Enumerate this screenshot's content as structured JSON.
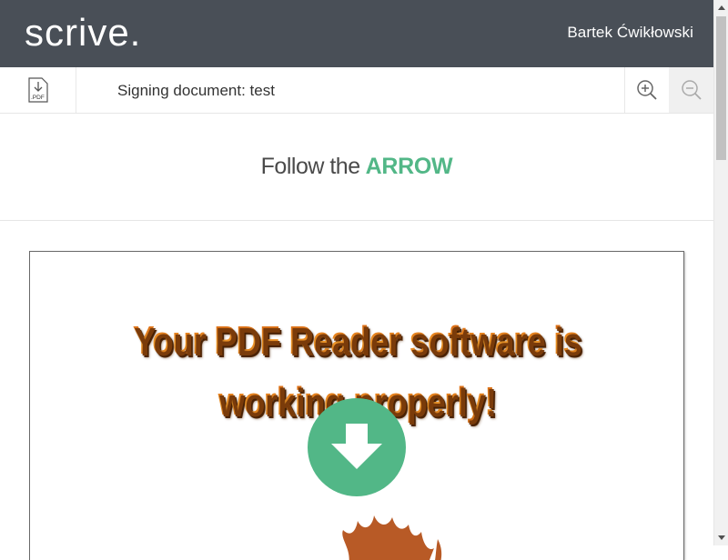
{
  "header": {
    "logo_text": "scrive.",
    "user_name": "Bartek Ćwikłowski",
    "background_color": "#494f57"
  },
  "toolbar": {
    "download_icon": "pdf-download-icon",
    "download_label": ".PDF",
    "title": "Signing document: test",
    "zoom_in_icon": "zoom-in-icon",
    "zoom_out_icon": "zoom-out-icon"
  },
  "banner": {
    "prefix": "Follow the",
    "highlight": "ARROW",
    "highlight_color": "#52b787"
  },
  "document": {
    "line1": "Your PDF Reader software is",
    "line2": "working properly!",
    "text_color": "#e07a1c",
    "arrow_icon": "arrow-down-icon",
    "arrow_color": "#52b787"
  },
  "scrollbar": {
    "up_icon": "scroll-up-arrow-icon",
    "down_icon": "scroll-down-arrow-icon"
  }
}
